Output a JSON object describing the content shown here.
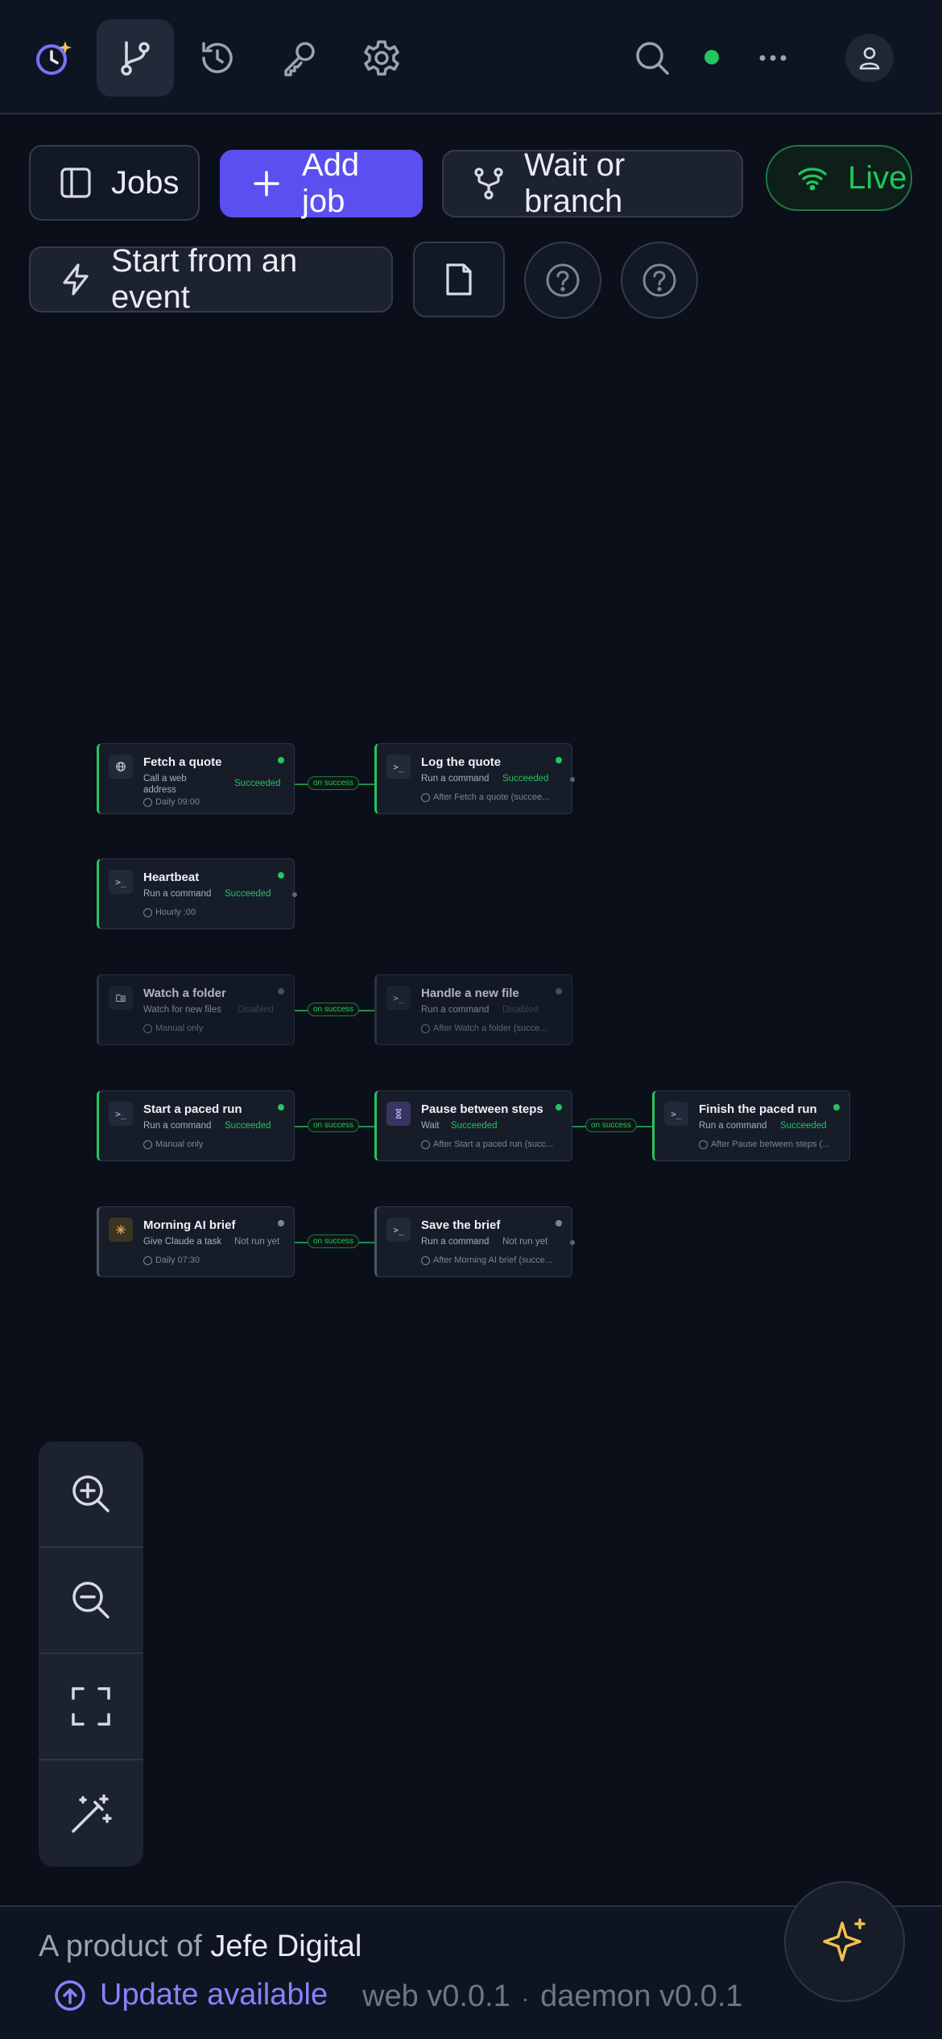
{
  "topbar": {
    "nav": [
      {
        "icon": "app-logo-clock-sparkle-icon"
      },
      {
        "icon": "branch-icon",
        "active": true
      },
      {
        "icon": "history-icon"
      },
      {
        "icon": "key-icon"
      },
      {
        "icon": "gear-icon"
      }
    ],
    "status_color": "#22c55e"
  },
  "toolbar": {
    "jobs_label": "Jobs",
    "add_job_label": "Add job",
    "wait_branch_label": "Wait or branch",
    "live_label": "Live",
    "start_event_label": "Start from an event"
  },
  "nodes": {
    "fetch": {
      "title": "Fetch a quote",
      "sub1": "Call a web",
      "sub2": "address",
      "status": "Succeeded",
      "schedule": "Daily 09:00"
    },
    "logq": {
      "title": "Log the quote",
      "sub": "Run a command",
      "status": "Succeeded",
      "schedule": "After Fetch a quote (succee..."
    },
    "heartbeat": {
      "title": "Heartbeat",
      "sub": "Run a command",
      "status": "Succeeded",
      "schedule": "Hourly :00"
    },
    "watch": {
      "title": "Watch a folder",
      "sub": "Watch for new files",
      "status": "Disabled",
      "schedule": "Manual only"
    },
    "handle": {
      "title": "Handle a new file",
      "sub": "Run a command",
      "status": "Disabled",
      "schedule": "After Watch a folder (succe..."
    },
    "paced": {
      "title": "Start a paced run",
      "sub": "Run a command",
      "status": "Succeeded",
      "schedule": "Manual only"
    },
    "pause": {
      "title": "Pause between steps",
      "sub": "Wait",
      "status": "Succeeded",
      "schedule": "After Start a paced run (succ..."
    },
    "finish": {
      "title": "Finish the paced run",
      "sub": "Run a command",
      "status": "Succeeded",
      "schedule": "After Pause between steps (..."
    },
    "brief": {
      "title": "Morning AI brief",
      "sub": "Give Claude a task",
      "status": "Not run yet",
      "schedule": "Daily 07:30"
    },
    "save": {
      "title": "Save the brief",
      "sub": "Run a command",
      "status": "Not run yet",
      "schedule": "After Morning AI brief (succe..."
    }
  },
  "edge_label": "on success",
  "footer": {
    "product_prefix": "A product of",
    "brand": "Jefe Digital",
    "update_label": "Update available",
    "web_version": "web v0.0.1",
    "separator": "·",
    "daemon_version": "daemon v0.0.1"
  },
  "colors": {
    "accent": "#5b4ff0",
    "success": "#22c55e",
    "background": "#0b0f1a"
  }
}
